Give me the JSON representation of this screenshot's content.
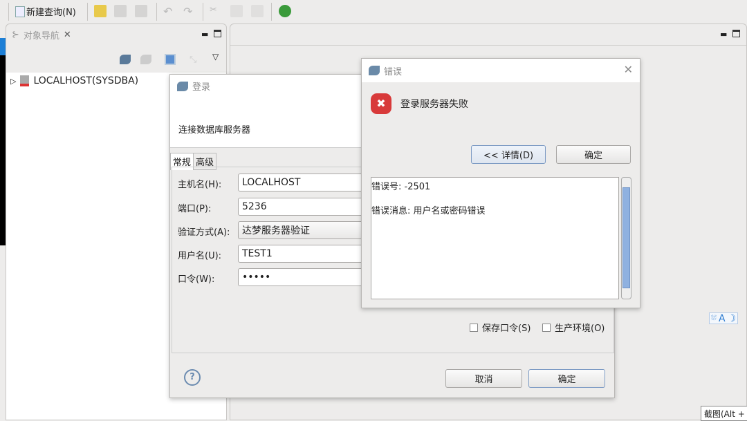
{
  "toolbar": {
    "new_query": "新建查询(N)",
    "icons": [
      "new-query-icon",
      "open-icon",
      "save-icon",
      "save-all-icon",
      "undo-icon",
      "redo-icon",
      "cut-icon",
      "copy-icon",
      "paste-icon",
      "debug-icon"
    ]
  },
  "navigator": {
    "tab": "对象导航",
    "tree": [
      {
        "label": "LOCALHOST(SYSDBA)"
      }
    ]
  },
  "login": {
    "title": "登录",
    "header": "连接数据库服务器",
    "tabs": [
      "常规",
      "高级"
    ],
    "fields": [
      {
        "label": "主机名(H):",
        "value": "LOCALHOST"
      },
      {
        "label": "端口(P):",
        "value": "5236"
      },
      {
        "label": "验证方式(A):",
        "value": "达梦服务器验证"
      },
      {
        "label": "用户名(U):",
        "value": "TEST1"
      },
      {
        "label": "口令(W):",
        "value": "•••••"
      }
    ],
    "save_password": "保存口令(S)",
    "production": "生产环境(O)",
    "cancel": "取消",
    "ok": "确定"
  },
  "error": {
    "title": "错误",
    "message": "登录服务器失败",
    "details_button": "<< 详情(D)",
    "ok": "确定",
    "detail_line1": "错误号:   -2501",
    "detail_line2": "错误消息: 用户名或密码错误"
  },
  "ime": {
    "label": "A"
  },
  "tooltip": "截图(Alt +"
}
